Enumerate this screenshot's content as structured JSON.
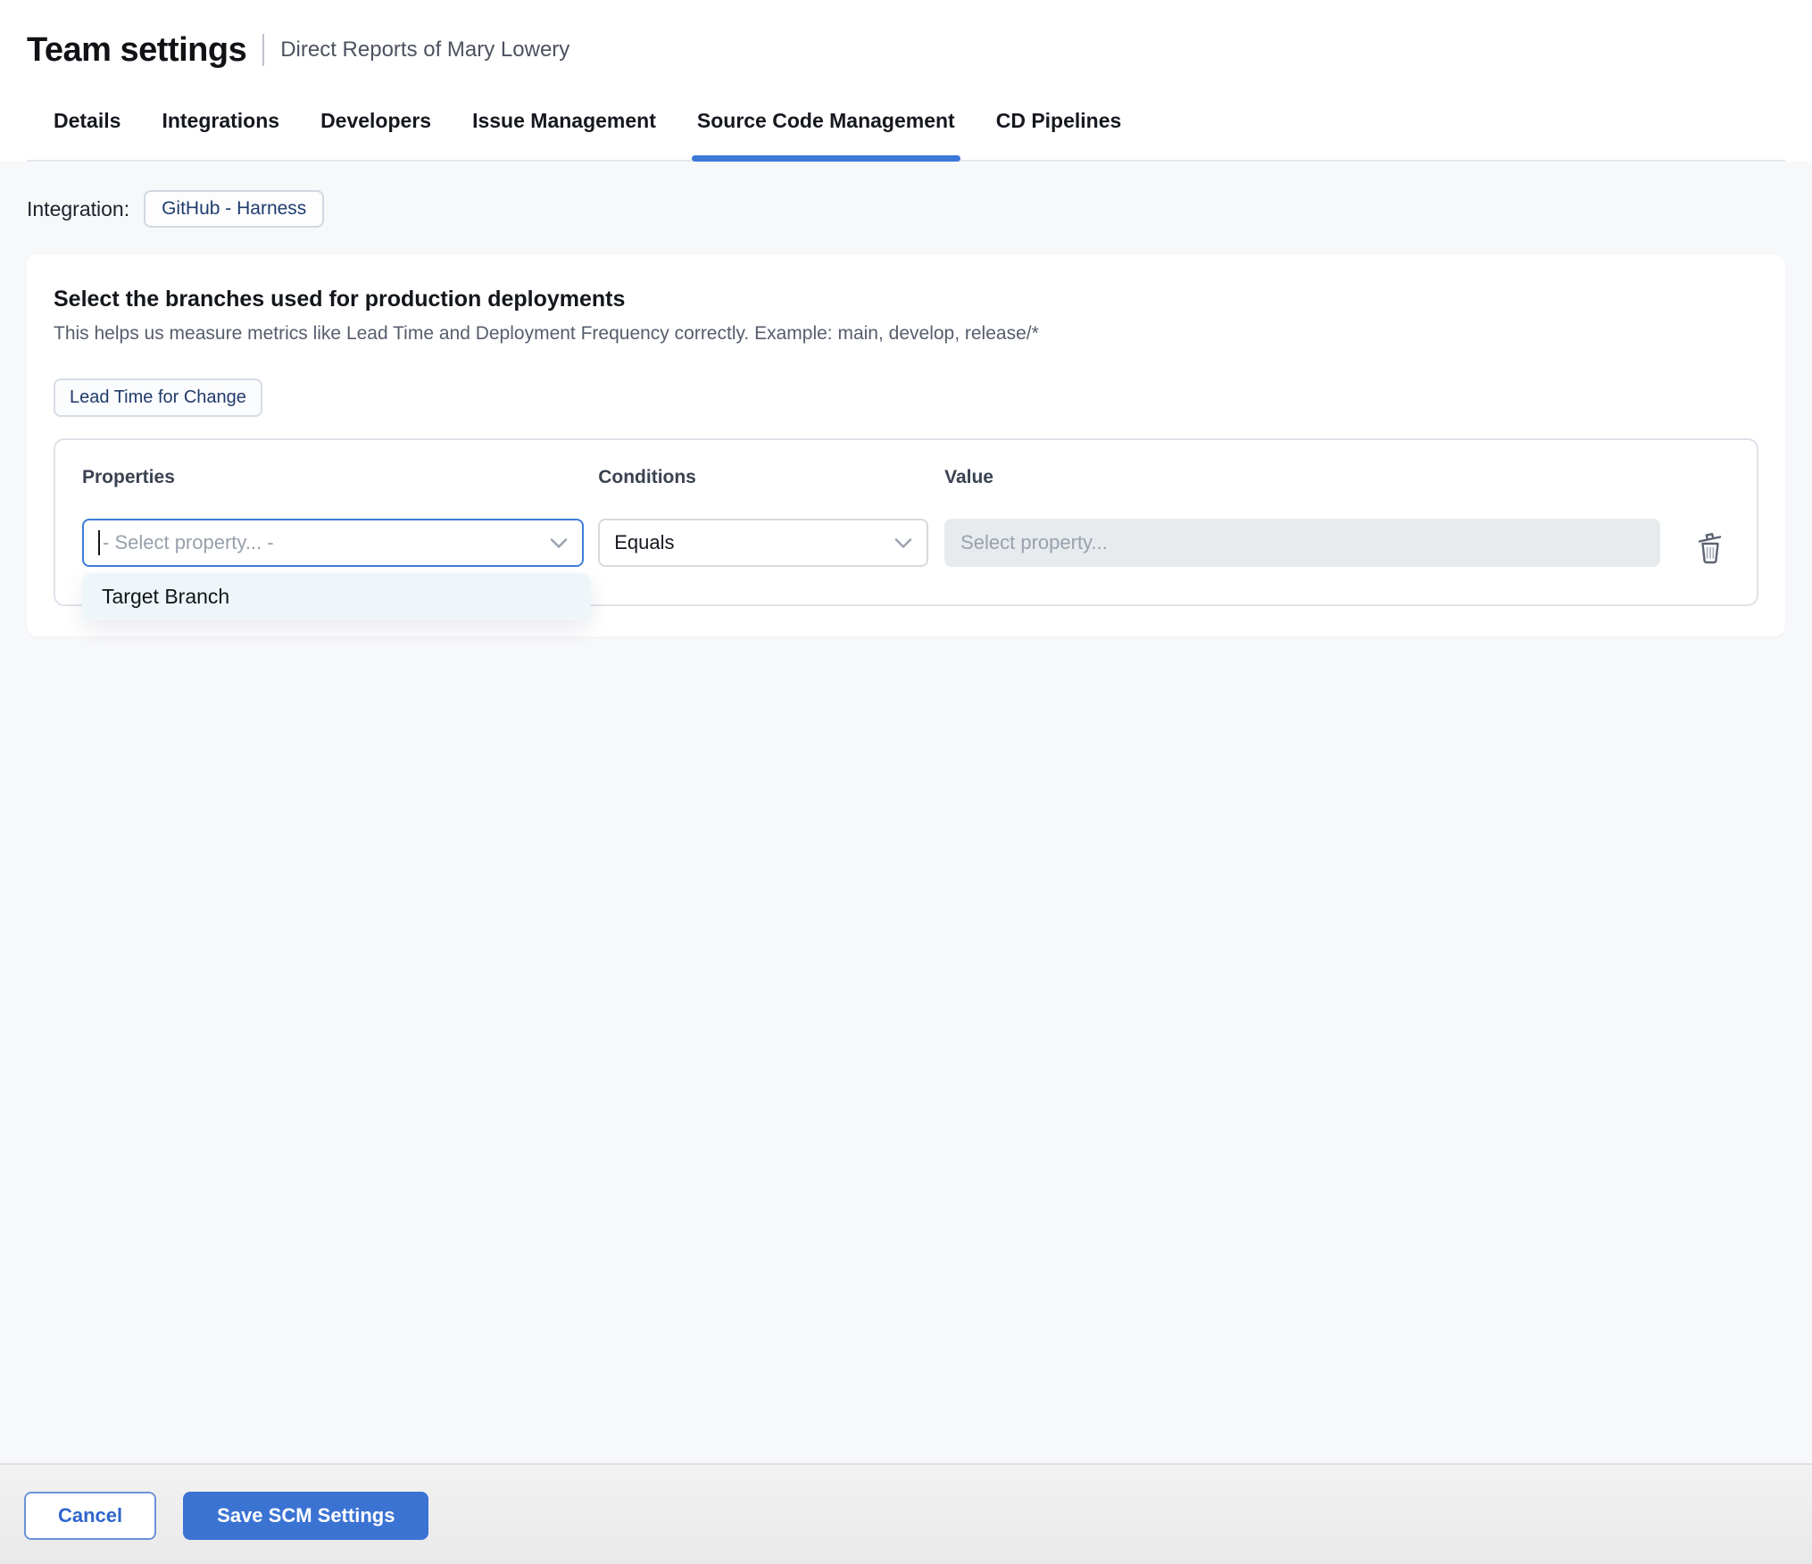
{
  "page": {
    "title": "Team settings",
    "subtitle": "Direct Reports of Mary Lowery"
  },
  "tabs": {
    "items": [
      {
        "label": "Details",
        "active": false
      },
      {
        "label": "Integrations",
        "active": false
      },
      {
        "label": "Developers",
        "active": false
      },
      {
        "label": "Issue Management",
        "active": false
      },
      {
        "label": "Source Code Management",
        "active": true
      },
      {
        "label": "CD Pipelines",
        "active": false
      }
    ]
  },
  "integration": {
    "label": "Integration:",
    "badge": "GitHub - Harness"
  },
  "card": {
    "heading": "Select the branches used for production deployments",
    "description": "This helps us measure metrics like Lead Time and Deployment Frequency correctly. Example: main, develop, release/*",
    "metric_chip": "Lead Time for Change",
    "rule": {
      "properties_label": "Properties",
      "conditions_label": "Conditions",
      "value_label": "Value",
      "property_placeholder": "- Select property... -",
      "condition_value": "Equals",
      "value_placeholder": "Select property...",
      "options": [
        "Target Branch"
      ]
    }
  },
  "footer": {
    "cancel_label": "Cancel",
    "save_label": "Save SCM Settings"
  },
  "icons": {
    "chevron": "chevron-down-icon",
    "trash": "trash-icon"
  },
  "colors": {
    "primary_blue": "#3b73d3",
    "tab_underline": "#3c78d8",
    "focus_border": "#3d7cd9",
    "chip_text_navy": "#1e3c6e",
    "dropdown_bg": "#eef6fa",
    "disabled_input_bg": "#e7ebee",
    "content_bg": "#f7f8fa"
  }
}
